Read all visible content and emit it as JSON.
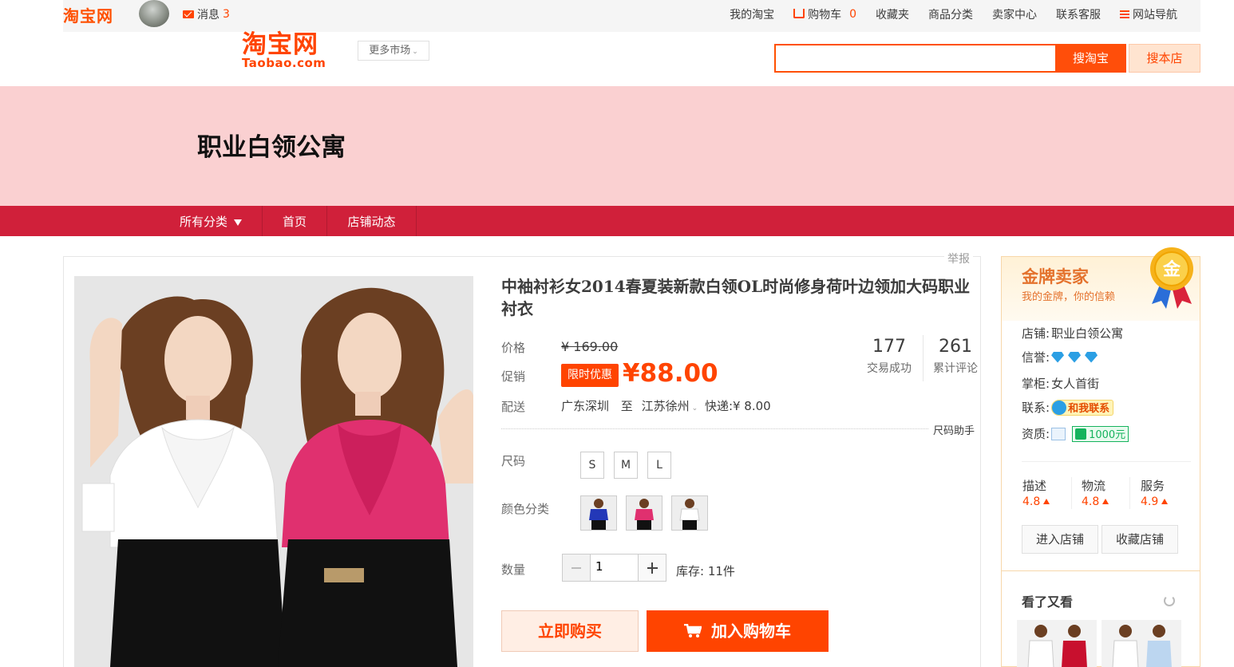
{
  "topbar": {
    "logo": "淘宝网",
    "message_label": "消息",
    "message_count": "3",
    "links": {
      "my_taobao": "我的淘宝",
      "cart": "购物车",
      "cart_count": "0",
      "favorites": "收藏夹",
      "categories": "商品分类",
      "seller_center": "卖家中心",
      "customer_service": "联系客服",
      "site_nav": "网站导航"
    }
  },
  "header": {
    "brand_cn": "淘宝网",
    "brand_en": "Taobao.com",
    "more_market": "更多市场",
    "search_placeholder": "",
    "search_button": "搜淘宝",
    "search_shop_button": "搜本店"
  },
  "shop": {
    "name": "职业白领公寓",
    "nav": {
      "all_categories": "所有分类",
      "home": "首页",
      "news": "店铺动态"
    }
  },
  "product": {
    "report": "举报",
    "title": "中袖衬衫女2014春夏装新款白领OL时尚修身荷叶边领加大码职业衬衣",
    "price_label": "价格",
    "old_price": "¥ 169.00",
    "promo_label": "促销",
    "promo_badge": "限时优惠",
    "sale_price": "¥88.00",
    "shipping_label": "配送",
    "ship_from": "广东深圳",
    "ship_to_word": "至",
    "ship_to": "江苏徐州",
    "ship_fee": "快递:¥ 8.00",
    "trades_count": "177",
    "trades_label": "交易成功",
    "reviews_count": "261",
    "reviews_label": "累计评论",
    "size_helper": "尺码助手",
    "size_label": "尺码",
    "sizes": [
      "S",
      "M",
      "L"
    ],
    "color_label": "颜色分类",
    "qty_label": "数量",
    "qty_value": "1",
    "stock": "库存: 11件",
    "buy_now": "立即购买",
    "add_to_cart": "加入购物车"
  },
  "seller": {
    "badge_title": "金牌卖家",
    "badge_sub": "我的金牌，你的信赖",
    "medal_char": "金",
    "shop_label": "店铺:",
    "shop_name": "职业白领公寓",
    "credit_label": "信誉:",
    "keeper_label": "掌柜:",
    "keeper_name": "女人首街",
    "contact_label": "联系:",
    "contact_button": "和我联系",
    "qualification_label": "资质:",
    "deposit": "1000元",
    "scores": [
      {
        "name": "描述",
        "value": "4.8"
      },
      {
        "name": "物流",
        "value": "4.8"
      },
      {
        "name": "服务",
        "value": "4.9"
      }
    ],
    "enter_shop": "进入店铺",
    "favorite_shop": "收藏店铺",
    "also_viewed": "看了又看"
  },
  "colors": {
    "accent": "#ff4400",
    "shop_nav": "#d0203a",
    "banner_bg": "#fad0d1"
  }
}
